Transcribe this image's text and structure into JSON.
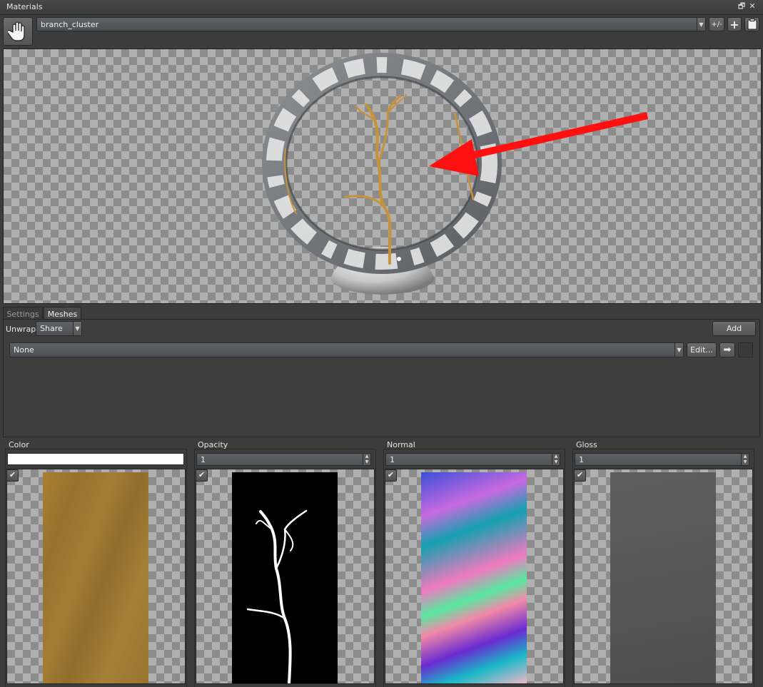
{
  "window": {
    "title": "Materials",
    "restore_glyph": "🗗",
    "close_glyph": "✕"
  },
  "toolbar": {
    "hand_icon": "hand-tool-icon",
    "material_name": "branch_cluster",
    "plusminus_label": "+/-",
    "add_glyph": "+",
    "clipboard_icon": "clipboard-icon"
  },
  "tabs": [
    {
      "label": "Settings",
      "active": false
    },
    {
      "label": "Meshes",
      "active": true
    }
  ],
  "meshes": {
    "unwrap_label": "Unwrap",
    "unwrap_value": "Share",
    "add_label": "Add",
    "mesh_select_value": "None",
    "edit_label": "Edit...",
    "arrow_glyph": "➡"
  },
  "channels": [
    {
      "name": "Color",
      "value": "",
      "swatch": "#ffffff",
      "enabled": true,
      "check": "✔"
    },
    {
      "name": "Opacity",
      "value": "1",
      "enabled": true,
      "check": "✔"
    },
    {
      "name": "Normal",
      "value": "1",
      "enabled": true,
      "check": "✔"
    },
    {
      "name": "Gloss",
      "value": "1",
      "enabled": true,
      "check": "✔"
    }
  ],
  "colors": {
    "accent_arrow": "#ff1010",
    "branch": "#c8923a",
    "color_texture": "#9d7a36",
    "gloss_texture": "#5a5a5a"
  }
}
